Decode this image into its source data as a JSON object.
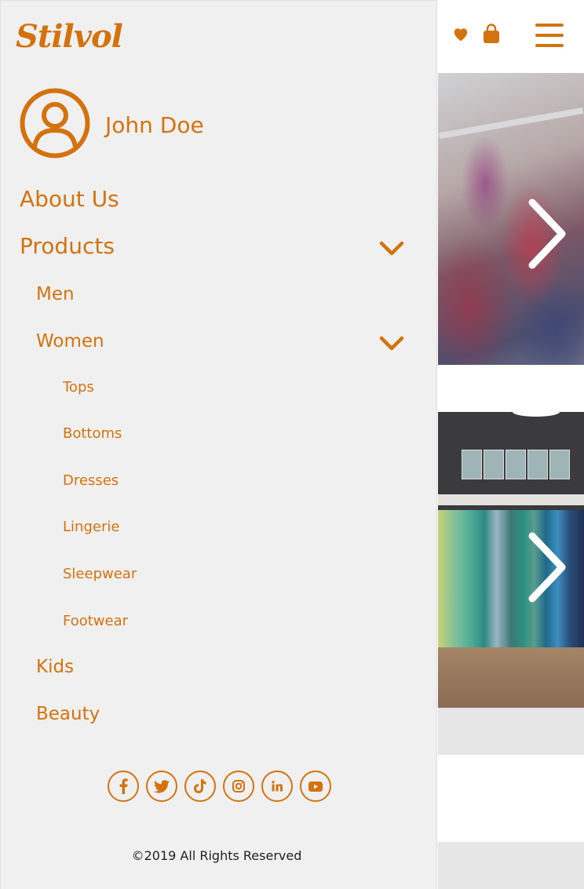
{
  "brand": {
    "logo_text": "Stilvol",
    "accent_color": "#d3730f"
  },
  "header_icons": [
    "heart-icon",
    "shopping-bag-icon",
    "hamburger-menu-icon"
  ],
  "user": {
    "name": "John Doe"
  },
  "menu": {
    "about": "About Us",
    "products": "Products",
    "men": "Men",
    "women": "Women",
    "women_items": [
      "Tops",
      "Bottoms",
      "Dresses",
      "Lingerie",
      "Sleepwear",
      "Footwear"
    ],
    "kids": "Kids",
    "beauty": "Beauty"
  },
  "socials": [
    "facebook-icon",
    "twitter-icon",
    "tiktok-icon",
    "instagram-icon",
    "linkedin-icon",
    "youtube-icon"
  ],
  "footer": {
    "copyright": "©2019 All Rights Reserved"
  }
}
